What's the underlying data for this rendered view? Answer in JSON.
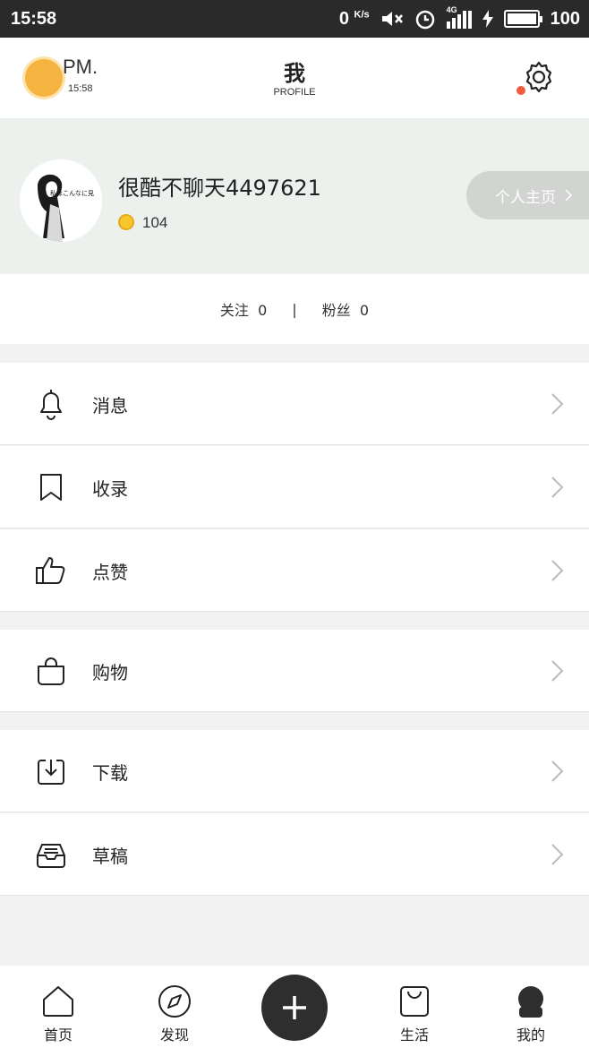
{
  "status_bar": {
    "time": "15:58",
    "speed": "0",
    "speed_unit": "K/s",
    "network": "4G",
    "battery": "100",
    "battery_level": 1.0
  },
  "header": {
    "weather_period": "PM.",
    "weather_time": "15:58",
    "title": "我",
    "subtitle": "PROFILE"
  },
  "profile": {
    "username": "很酷不聊天4497621",
    "avatar_caption": "私はこんなに見",
    "coins": "104",
    "homepage_label": "个人主页",
    "following_label": "关注",
    "following_count": "0",
    "separator": "|",
    "fans_label": "粉丝",
    "fans_count": "0"
  },
  "menu": [
    {
      "label": "消息",
      "icon": "bell-icon"
    },
    {
      "label": "收录",
      "icon": "bookmark-icon"
    },
    {
      "label": "点赞",
      "icon": "thumbs-up-icon"
    },
    {
      "label": "购物",
      "icon": "shopping-bag-icon"
    },
    {
      "label": "下载",
      "icon": "download-icon"
    },
    {
      "label": "草稿",
      "icon": "inbox-tray-icon"
    }
  ],
  "bottom_nav": [
    {
      "label": "首页",
      "icon": "home-icon"
    },
    {
      "label": "发现",
      "icon": "compass-icon"
    },
    {
      "label": "",
      "icon": "plus-icon"
    },
    {
      "label": "生活",
      "icon": "bag-icon"
    },
    {
      "label": "我的",
      "icon": "user-icon"
    }
  ],
  "colors": {
    "accent_dot": "#f25a3c",
    "coin": "#f7c52e",
    "profile_bg": "#edf1ee",
    "dark": "#2e2e2e"
  }
}
